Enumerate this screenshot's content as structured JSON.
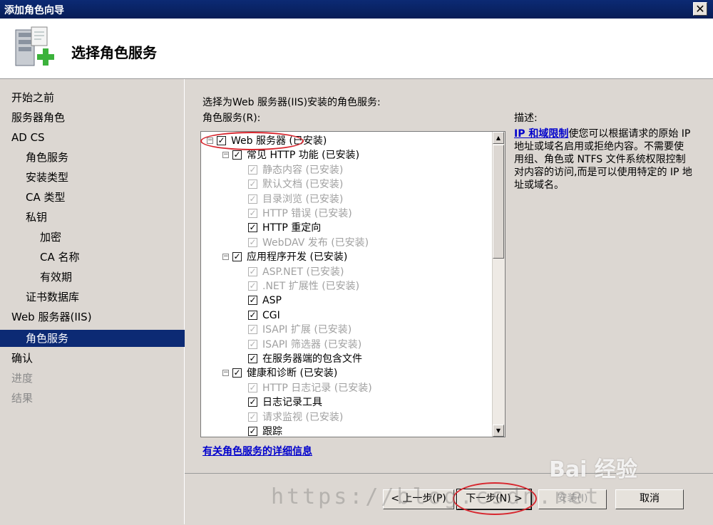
{
  "window": {
    "title": "添加角色向导",
    "close_glyph": "✕"
  },
  "header": {
    "title": "选择角色服务",
    "icon": "server-add-icon"
  },
  "nav": {
    "items": [
      {
        "label": "开始之前",
        "state": "normal"
      },
      {
        "label": "服务器角色",
        "state": "normal"
      },
      {
        "label": "AD CS",
        "state": "normal"
      },
      {
        "label": "角色服务",
        "state": "normal"
      },
      {
        "label": "安装类型",
        "state": "normal"
      },
      {
        "label": "CA 类型",
        "state": "normal"
      },
      {
        "label": "私钥",
        "state": "normal"
      },
      {
        "label": "加密",
        "state": "normal"
      },
      {
        "label": "CA 名称",
        "state": "normal"
      },
      {
        "label": "有效期",
        "state": "normal"
      },
      {
        "label": "证书数据库",
        "state": "normal"
      },
      {
        "label": "Web 服务器(IIS)",
        "state": "normal"
      },
      {
        "label": "角色服务",
        "state": "selected"
      },
      {
        "label": "确认",
        "state": "normal"
      },
      {
        "label": "进度",
        "state": "disabled"
      },
      {
        "label": "结果",
        "state": "disabled"
      }
    ]
  },
  "main": {
    "instruction": "选择为Web 服务器(IIS)安装的角色服务:",
    "list_label": "角色服务(R):",
    "description_label": "描述:",
    "description_link": "IP 和域限制",
    "description_text": "使您可以根据请求的原始 IP 地址或域名启用或拒绝内容。不需要使用组、角色或 NTFS 文件系统权限控制对内容的访问,而是可以使用特定的 IP 地址或域名。",
    "tree": [
      {
        "label": "Web 服务器",
        "status": "(已安装)",
        "checked": true,
        "disabled": false,
        "expander": "⊟"
      },
      {
        "label": "常见 HTTP 功能",
        "status": "(已安装)",
        "checked": true,
        "disabled": false,
        "expander": "⊟"
      },
      {
        "label": "静态内容",
        "status": "(已安装)",
        "checked": true,
        "disabled": true
      },
      {
        "label": "默认文档",
        "status": "(已安装)",
        "checked": true,
        "disabled": true
      },
      {
        "label": "目录浏览",
        "status": "(已安装)",
        "checked": true,
        "disabled": true
      },
      {
        "label": "HTTP 错误",
        "status": "(已安装)",
        "checked": true,
        "disabled": true
      },
      {
        "label": "HTTP 重定向",
        "status": "",
        "checked": true,
        "disabled": false
      },
      {
        "label": "WebDAV 发布",
        "status": "(已安装)",
        "checked": true,
        "disabled": true
      },
      {
        "label": "应用程序开发",
        "status": "(已安装)",
        "checked": true,
        "disabled": false,
        "expander": "⊟"
      },
      {
        "label": "ASP.NET",
        "status": "(已安装)",
        "checked": true,
        "disabled": true
      },
      {
        "label": ".NET 扩展性",
        "status": "(已安装)",
        "checked": true,
        "disabled": true
      },
      {
        "label": "ASP",
        "status": "",
        "checked": true,
        "disabled": false
      },
      {
        "label": "CGI",
        "status": "",
        "checked": true,
        "disabled": false
      },
      {
        "label": "ISAPI 扩展",
        "status": "(已安装)",
        "checked": true,
        "disabled": true
      },
      {
        "label": "ISAPI 筛选器",
        "status": "(已安装)",
        "checked": true,
        "disabled": true
      },
      {
        "label": "在服务器端的包含文件",
        "status": "",
        "checked": true,
        "disabled": false
      },
      {
        "label": "健康和诊断",
        "status": "(已安装)",
        "checked": true,
        "disabled": false,
        "expander": "⊟"
      },
      {
        "label": "HTTP 日志记录",
        "status": "(已安装)",
        "checked": true,
        "disabled": true
      },
      {
        "label": "日志记录工具",
        "status": "",
        "checked": true,
        "disabled": false
      },
      {
        "label": "请求监视",
        "status": "(已安装)",
        "checked": true,
        "disabled": true
      },
      {
        "label": "跟踪",
        "status": "",
        "checked": true,
        "disabled": false
      }
    ],
    "more_info_link": "有关角色服务的详细信息",
    "check_glyph": "✓"
  },
  "footer": {
    "prev": "< 上一步(P)",
    "next": "下一步(N) >",
    "install": "安装(I)",
    "cancel": "取消"
  },
  "overlay": {
    "watermark": "https://blog.csdn.net",
    "logo": "Bai 经验"
  }
}
